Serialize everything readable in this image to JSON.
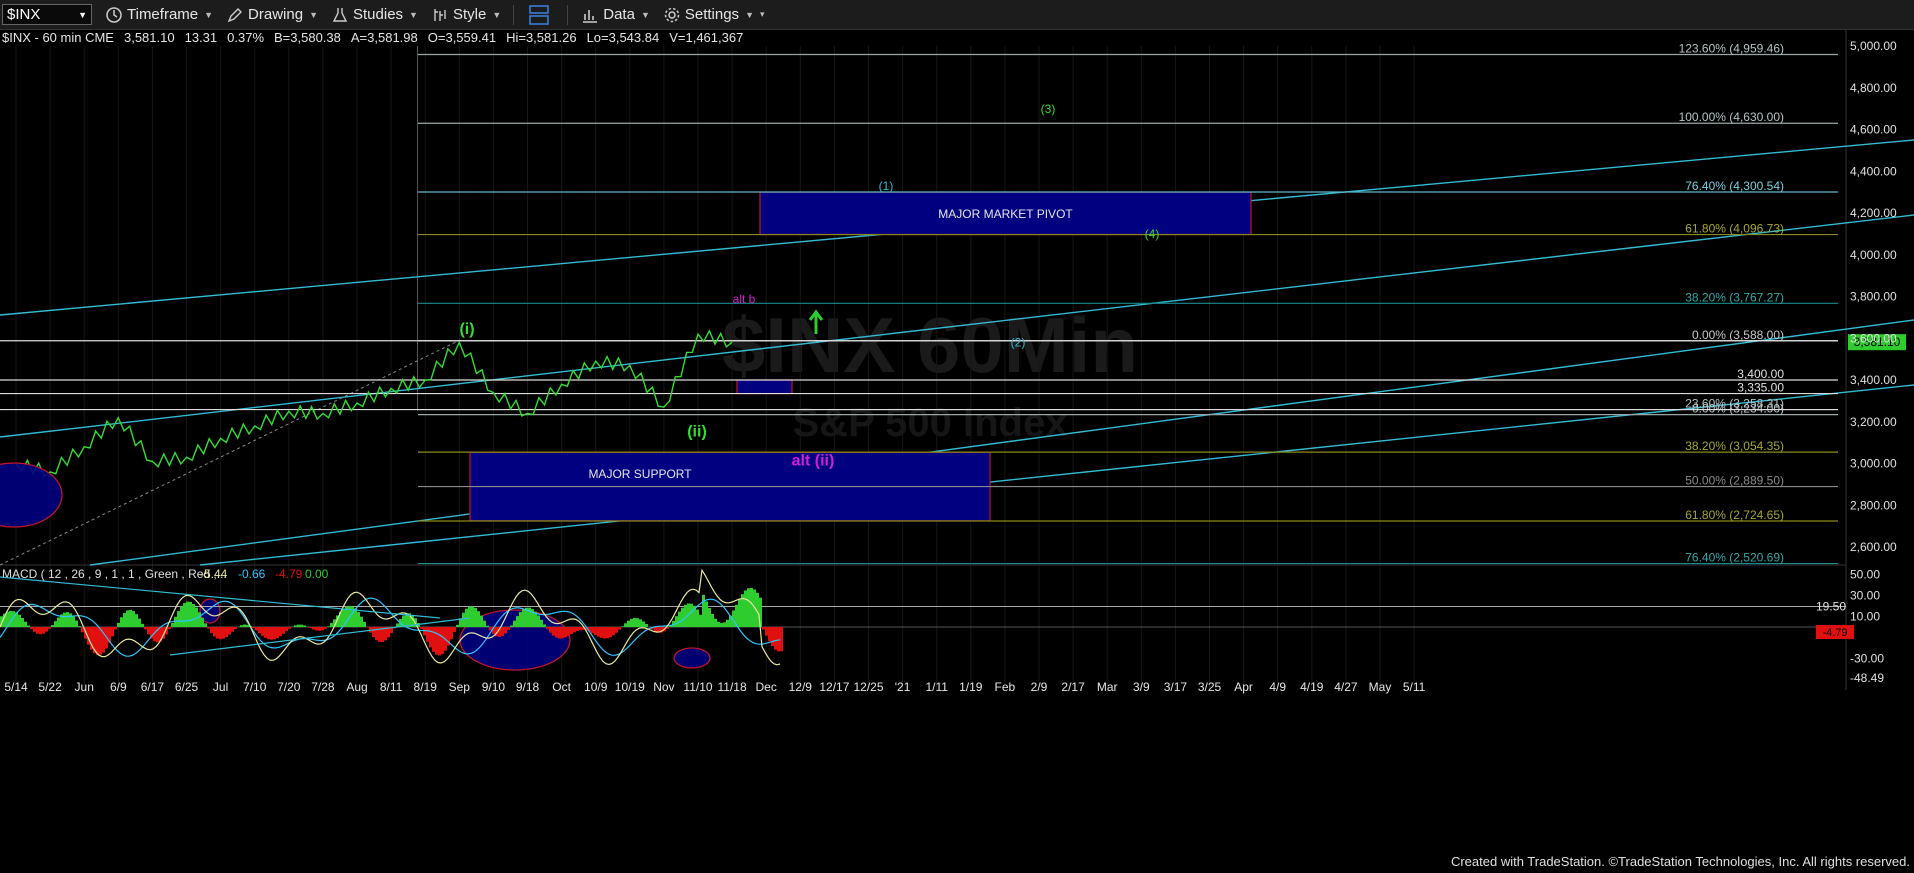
{
  "toolbar": {
    "symbol": "$INX",
    "items": [
      {
        "name": "timeframe",
        "label": "Timeframe"
      },
      {
        "name": "drawing",
        "label": "Drawing"
      },
      {
        "name": "studies",
        "label": "Studies"
      },
      {
        "name": "style",
        "label": "Style"
      },
      {
        "name": "data",
        "label": "Data"
      },
      {
        "name": "settings",
        "label": "Settings"
      }
    ]
  },
  "info": {
    "symbol_line": "$INX - 60 min  CME",
    "last": "3,581.10",
    "change": "13.31",
    "change_pct": "0.37%",
    "bid": "B=3,580.38",
    "ask": "A=3,581.98",
    "open": "O=3,559.41",
    "high": "Hi=3,581.26",
    "low": "Lo=3,543.84",
    "volume": "V=1,461,367"
  },
  "watermark": {
    "title": "$INX 60Min",
    "subtitle": "S&P 500 Index"
  },
  "footer": "Created with TradeStation. ©TradeStation Technologies, Inc. All rights reserved.",
  "colors": {
    "price": "#33dd33",
    "channel": "#33bbd3",
    "wave_green": "#33dd33",
    "wave_cyan": "#33bbd3",
    "wave_magenta": "#d11fd1",
    "box_fill": "#000080",
    "box_border": "#c0152a",
    "macd": "#e8e8a0",
    "signal": "#2ec4ff",
    "hist_up": "#2ecc2e",
    "hist_down": "#e01010"
  },
  "chart_data": {
    "type": "line",
    "title": "$INX - 60 min",
    "y_axis_ticks": [
      2600,
      2800,
      3000,
      3200,
      3400,
      3600,
      3800,
      4000,
      4200,
      4400,
      4600,
      4800,
      5000
    ],
    "y_axis_labels": [
      "2,600.00",
      "2,800.00",
      "3,000.00",
      "3,200.00",
      "3,400.00",
      "3,600.00",
      "3,800.00",
      "4,000.00",
      "4,200.00",
      "4,400.00",
      "4,600.00",
      "4,800.00",
      "5,000.00"
    ],
    "ylim": [
      2450,
      5050
    ],
    "x_tick_labels": [
      "5/14",
      "5/22",
      "Jun",
      "6/9",
      "6/17",
      "6/25",
      "Jul",
      "7/10",
      "7/20",
      "7/28",
      "Aug",
      "8/11",
      "8/19",
      "Sep",
      "9/10",
      "9/18",
      "Oct",
      "10/9",
      "10/19",
      "Nov",
      "11/10",
      "11/18",
      "Dec",
      "12/9",
      "12/17",
      "12/25",
      "'21",
      "1/11",
      "1/19",
      "Feb",
      "2/9",
      "2/17",
      "Mar",
      "3/9",
      "3/17",
      "3/25",
      "Apr",
      "4/9",
      "4/19",
      "4/27",
      "May",
      "5/11"
    ],
    "last_price_label": "3,581.10",
    "price_series": [
      {
        "x": "5/14",
        "y": 3000
      },
      {
        "x": "5/22",
        "y": 2960
      },
      {
        "x": "Jun",
        "y": 3080
      },
      {
        "x": "6/9",
        "y": 3220
      },
      {
        "x": "6/17",
        "y": 3010
      },
      {
        "x": "6/25",
        "y": 3030
      },
      {
        "x": "Jul",
        "y": 3120
      },
      {
        "x": "7/10",
        "y": 3180
      },
      {
        "x": "7/20",
        "y": 3250
      },
      {
        "x": "7/28",
        "y": 3240
      },
      {
        "x": "Aug",
        "y": 3290
      },
      {
        "x": "8/11",
        "y": 3360
      },
      {
        "x": "8/19",
        "y": 3400
      },
      {
        "x": "Sep",
        "y": 3580
      },
      {
        "x": "9/10",
        "y": 3340
      },
      {
        "x": "9/18",
        "y": 3240
      },
      {
        "x": "Oct",
        "y": 3380
      },
      {
        "x": "10/9",
        "y": 3490
      },
      {
        "x": "10/19",
        "y": 3470
      },
      {
        "x": "Nov",
        "y": 3270
      },
      {
        "x": "11/10",
        "y": 3620
      },
      {
        "x": "11/18",
        "y": 3581
      }
    ],
    "fib_levels": [
      {
        "label": "123.60% (4,959.46)",
        "value": 4959.46,
        "color": "#9aa6a6"
      },
      {
        "label": "100.00% (4,630.00)",
        "value": 4630.0,
        "color": "#9aa6a6"
      },
      {
        "label": "76.40% (4,300.54)",
        "value": 4300.54,
        "color": "#5fb8c8"
      },
      {
        "label": "61.80% (4,096.73)",
        "value": 4096.73,
        "color": "#8a8a1a"
      },
      {
        "label": "38.20% (3,767.27)",
        "value": 3767.27,
        "color": "#1a8a8a"
      },
      {
        "label": "0.00% (3,588.00)",
        "value": 3588.0,
        "color": "#d0d0d0"
      },
      {
        "label": "23.60% (3,258.31)",
        "value": 3258.31,
        "color": "#9aa6a6"
      },
      {
        "label": "0.00% (3,234.00)",
        "value": 3234.0,
        "color": "#9aa6a6"
      },
      {
        "label": "38.20% (3,054.35)",
        "value": 3054.35,
        "color": "#8a8a1a"
      },
      {
        "label": "50.00% (2,889.50)",
        "value": 2889.5,
        "color": "#8a8a8a"
      },
      {
        "label": "61.80% (2,724.65)",
        "value": 2724.65,
        "color": "#8a8a1a"
      },
      {
        "label": "76.40% (2,520.69)",
        "value": 2520.69,
        "color": "#1a8a8a"
      }
    ],
    "horizontal_levels": [
      {
        "label": "3,400.00",
        "value": 3400.0
      },
      {
        "label": "3,335.00",
        "value": 3335.0
      }
    ],
    "boxes": [
      {
        "label": "MAJOR MARKET PIVOT",
        "from": "11/25",
        "to": "3/17",
        "top": 4300,
        "bottom": 4097
      },
      {
        "label": "MAJOR SUPPORT",
        "from": "9/1",
        "to": "1/6",
        "top": 3054,
        "bottom": 2725
      },
      {
        "label": "",
        "from": "11/13",
        "to": "11/21",
        "top": 3400,
        "bottom": 3335
      }
    ],
    "wave_labels": [
      {
        "text": "(i)",
        "x": "Sep",
        "y": 3620,
        "color": "green"
      },
      {
        "text": "(ii)",
        "x": "Nov",
        "y": 3130,
        "color": "green"
      },
      {
        "text": "(3)",
        "x": "1/19",
        "y": 4680,
        "color": "green"
      },
      {
        "text": "(4)",
        "x": "2/17",
        "y": 4080,
        "color": "green"
      },
      {
        "text": "(1)",
        "x": "12/9",
        "y": 4310,
        "color": "cyan"
      },
      {
        "text": "(2)",
        "x": "1/11",
        "y": 3560,
        "color": "cyan"
      },
      {
        "text": "alt b",
        "x": "11/18",
        "y": 3770,
        "color": "magenta"
      },
      {
        "text": "alt (ii)",
        "x": "Dec",
        "y": 2990,
        "color": "magenta"
      }
    ],
    "macd": {
      "label": "MACD ( 12 , 26 , 9 , 1 , 1 , Green , Red ,...",
      "macd": "-5.44",
      "signal": "-0.66",
      "hist": "-4.79",
      "zero": "0.00",
      "y_axis_labels": [
        "50.00",
        "30.00",
        "19.50",
        "10.00",
        "-30.00",
        "-48.49"
      ],
      "last_label": "-4.79"
    }
  }
}
